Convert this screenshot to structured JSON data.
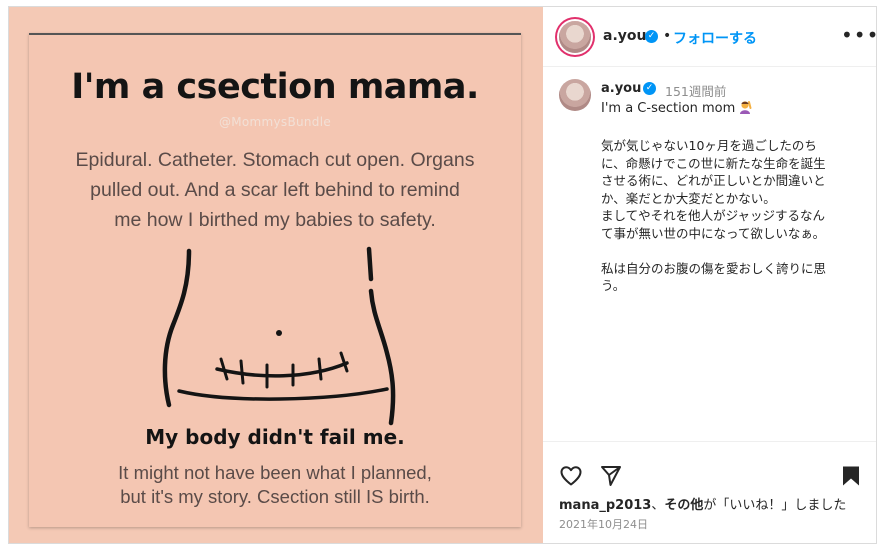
{
  "post_image": {
    "title": "I'm a csection mama.",
    "handle": "@MommysBundle",
    "lines": [
      "Epidural. Catheter. Stomach cut open. Organs",
      "pulled out. And a scar left behind to remind",
      "me how I birthed my babies to safety."
    ],
    "subtitle": "My body didn't fail me.",
    "footer_lines": [
      "It might not have been what I planned,",
      "but it's my story. Csection still IS birth."
    ]
  },
  "header": {
    "username": "a.you",
    "dot": "•",
    "follow_label": "フォローする",
    "more_icon": "more-options-icon"
  },
  "caption": {
    "username": "a.you",
    "time_ago": "151週間前",
    "first_line": "I'm a C-section mom",
    "emoji": "raising-hand-emoji",
    "body": "気が気じゃない10ヶ月を過ごしたのち\nに、命懸けでこの世に新たな生命を誕生\nさせる術に、どれが正しいとか間違いと\nか、楽だとか大変だとかない。\nましてやそれを他人がジャッジするなん\nて事が無い世の中になって欲しいなぁ。\n\n私は自分のお腹の傷を愛おしく誇りに思\nう。"
  },
  "actions": {
    "like_icon": "heart-icon",
    "share_icon": "send-icon",
    "save_icon": "bookmark-icon",
    "likes_user": "mana_p2013",
    "likes_sep": "、",
    "likes_others": "その他",
    "likes_suffix": "が「いいね！」しました",
    "date": "2021年10月24日"
  },
  "colors": {
    "accent": "#0095f6",
    "card_background": "#f4c6b2"
  }
}
